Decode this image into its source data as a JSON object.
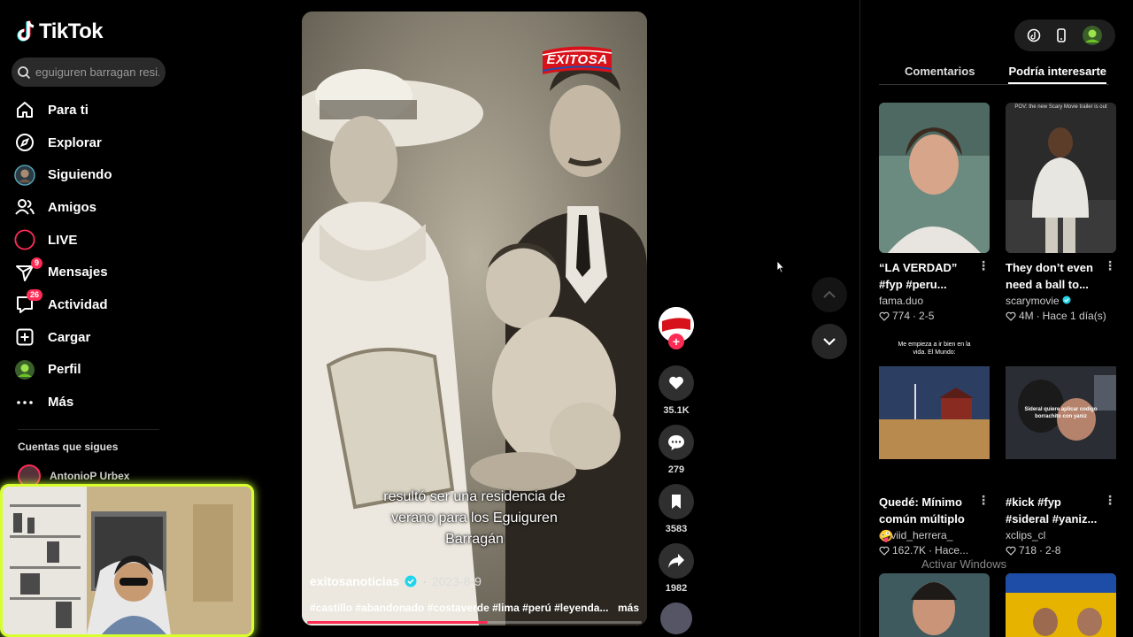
{
  "app": {
    "name": "TikTok"
  },
  "search": {
    "placeholder": "eguiguren barragan resi..."
  },
  "nav": [
    {
      "label": "Para ti",
      "icon": "home-icon"
    },
    {
      "label": "Explorar",
      "icon": "compass-icon"
    },
    {
      "label": "Siguiendo",
      "icon": "following-avatar-icon"
    },
    {
      "label": "Amigos",
      "icon": "friends-icon"
    },
    {
      "label": "LIVE",
      "icon": "live-icon"
    },
    {
      "label": "Mensajes",
      "icon": "messages-icon",
      "badge": "9"
    },
    {
      "label": "Actividad",
      "icon": "activity-icon",
      "badge": "26"
    },
    {
      "label": "Cargar",
      "icon": "upload-icon"
    },
    {
      "label": "Perfil",
      "icon": "profile-avatar-icon"
    },
    {
      "label": "Más",
      "icon": "more-icon"
    }
  ],
  "following": {
    "title": "Cuentas que sigues",
    "accounts": [
      {
        "name": "AntonioP Urbex"
      }
    ]
  },
  "video": {
    "brand": "EXITOSA",
    "caption_lines": [
      "resultó ser una residencia de",
      "verano para los Eguiguren",
      "Barragán"
    ],
    "author": "exitosanoticias",
    "date": "2023-8-9",
    "hashtags": "#castillo #abandonado #costaverde #lima #perú #leyenda...",
    "more": "más",
    "progress": 0.54
  },
  "actions": {
    "likes": "35.1K",
    "comments": "279",
    "saves": "3583",
    "shares": "1982"
  },
  "right": {
    "tabs": [
      "Comentarios",
      "Podría interesarte"
    ],
    "active_tab": 1,
    "cards": [
      {
        "title": "“LA VERDAD” #fyp #peru...",
        "author": "fama.duo",
        "likes": "774",
        "date": "2-5",
        "verified": false,
        "thumb_text": ""
      },
      {
        "title": "They don’t even need a ball to...",
        "author": "scarymovie",
        "likes": "4M",
        "date": "Hace 1 día(s)",
        "verified": true,
        "thumb_text": "POV: the new Scary Movie trailer is out"
      },
      {
        "title": "Quedé: Mínimo común múltiplo 🤪",
        "author": "daviid_herrera_",
        "likes": "162.7K",
        "date": "Hace...",
        "verified": false,
        "thumb_text": "Me empieza a ir bien en la vida. El Mundo:"
      },
      {
        "title": "#kick #fyp #sideral #yaniz...",
        "author": "xclips_cl",
        "likes": "718",
        "date": "2-8",
        "verified": false,
        "thumb_text": "Sideral quiere aplicar codigo borrachito con yaniz"
      }
    ]
  },
  "os": {
    "watermark": "Activar Windows"
  },
  "colors": {
    "accent": "#fe2c55",
    "verified": "#20d5ec",
    "webcam_border": "#d7ff2e"
  }
}
